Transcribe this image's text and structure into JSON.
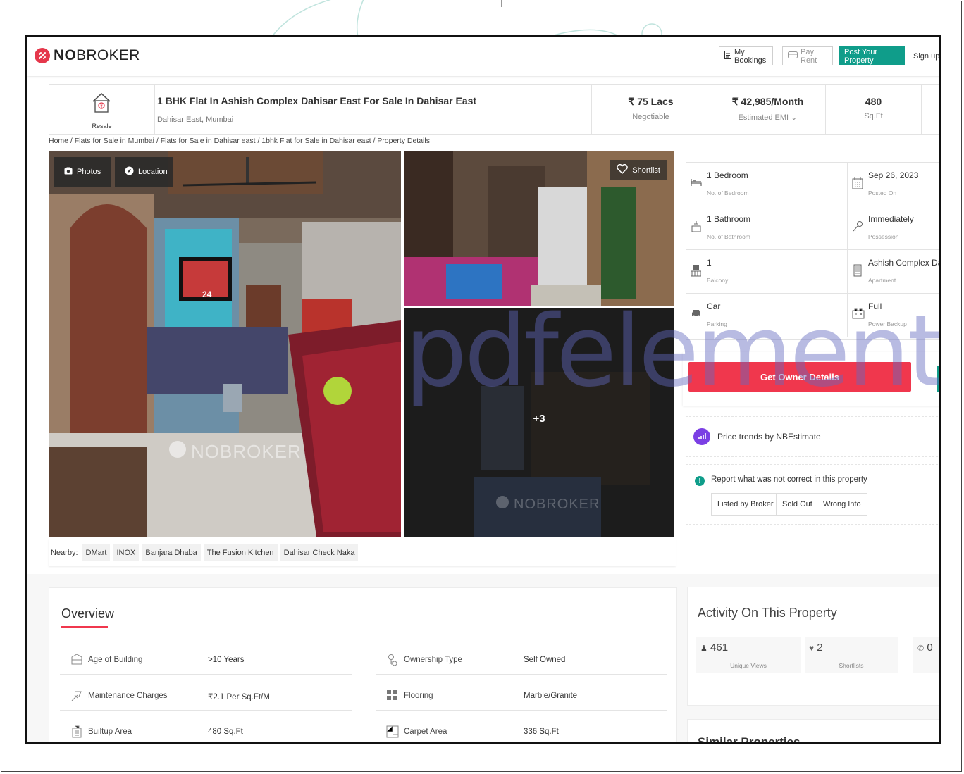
{
  "header": {
    "logo_prefix": "NO",
    "logo_suffix": "BROKER",
    "my_bookings": "My Bookings",
    "pay_rent": "Pay Rent",
    "post_property": "Post Your Property",
    "sign_up": "Sign up"
  },
  "listing": {
    "type_label": "Resale",
    "title": "1 BHK Flat In Ashish Complex Dahisar East For Sale In Dahisar East",
    "location": "Dahisar East, Mumbai",
    "price": "₹ 75 Lacs",
    "price_note": "Negotiable",
    "emi": "₹ 42,985/Month",
    "emi_note": "Estimated EMI ⌄",
    "area": "480",
    "area_unit": "Sq.Ft"
  },
  "breadcrumb": "Home / Flats for Sale in Mumbai / Flats for Sale in Dahisar east / 1bhk Flat for Sale in Dahisar east / Property Details",
  "gallery": {
    "photos_label": "Photos",
    "location_label": "Location",
    "shortlist_label": "Shortlist",
    "more_count": "+3",
    "watermark": "NOBROKER",
    "tv_number": "24"
  },
  "nearby": {
    "label": "Nearby:",
    "places": [
      "DMart",
      "INOX",
      "Banjara Dhaba",
      "The Fusion Kitchen",
      "Dahisar Check Naka"
    ]
  },
  "details": [
    {
      "value": "1 Bedroom",
      "label": "No. of Bedroom",
      "icon": "bed-icon"
    },
    {
      "value": "Sep 26, 2023",
      "label": "Posted On",
      "icon": "calendar-icon"
    },
    {
      "value": "1 Bathroom",
      "label": "No. of Bathroom",
      "icon": "bath-icon"
    },
    {
      "value": "Immediately",
      "label": "Possession",
      "icon": "key-icon"
    },
    {
      "value": "1",
      "label": "Balcony",
      "icon": "balcony-icon"
    },
    {
      "value": "Ashish Complex Da...",
      "label": "Apartment",
      "icon": "building-icon"
    },
    {
      "value": "Car",
      "label": "Parking",
      "icon": "car-icon"
    },
    {
      "value": "Full",
      "label": "Power Backup",
      "icon": "battery-icon"
    }
  ],
  "actions": {
    "get_owner": "Get Owner Details",
    "price_trend": "Price trends by NBEstimate",
    "report_text": "Report what was not correct in this property",
    "report_options": [
      "Listed by Broker",
      "Sold Out",
      "Wrong Info"
    ]
  },
  "overview": {
    "title": "Overview",
    "rows": [
      {
        "key": "Age of Building",
        "value": ">10 Years",
        "icon": "building-age-icon"
      },
      {
        "key": "Ownership Type",
        "value": "Self Owned",
        "icon": "ownership-icon"
      },
      {
        "key": "Maintenance Charges",
        "value": "₹2.1 Per Sq.Ft/M",
        "icon": "maintenance-icon"
      },
      {
        "key": "Flooring",
        "value": "Marble/Granite",
        "icon": "flooring-icon"
      },
      {
        "key": "Builtup Area",
        "value": "480 Sq.Ft",
        "icon": "builtup-icon"
      },
      {
        "key": "Carpet Area",
        "value": "336 Sq.Ft",
        "icon": "carpet-icon"
      }
    ]
  },
  "activity": {
    "title": "Activity On This Property",
    "views": "461",
    "views_label": "Unique Views",
    "shortlists": "2",
    "shortlists_label": "Shortlists",
    "contacts": "0"
  },
  "similar_title": "Similar Properties",
  "watermark_text": "pdfelement",
  "colors": {
    "brand_red": "#f0374d",
    "brand_teal": "#0f9d8a",
    "purple": "#7b3fe4"
  }
}
